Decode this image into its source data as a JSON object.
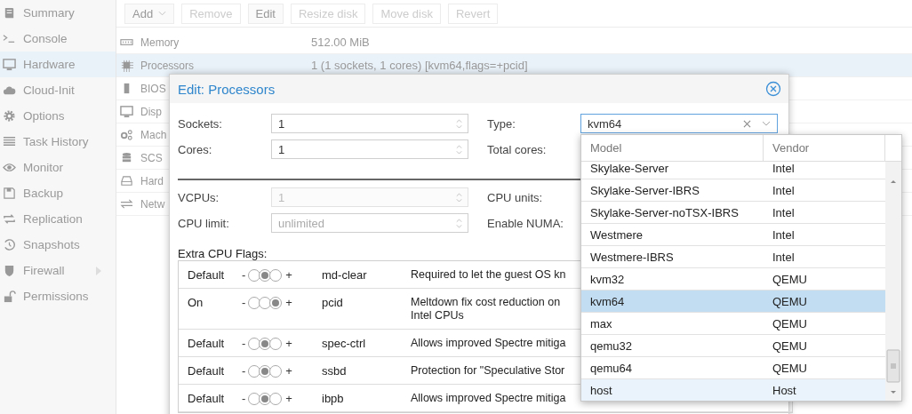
{
  "sidebar": {
    "items": [
      {
        "label": "Summary",
        "selected": false,
        "expandable": false
      },
      {
        "label": "Console",
        "selected": false,
        "expandable": false
      },
      {
        "label": "Hardware",
        "selected": true,
        "expandable": false
      },
      {
        "label": "Cloud-Init",
        "selected": false,
        "expandable": false
      },
      {
        "label": "Options",
        "selected": false,
        "expandable": false
      },
      {
        "label": "Task History",
        "selected": false,
        "expandable": false
      },
      {
        "label": "Monitor",
        "selected": false,
        "expandable": false
      },
      {
        "label": "Backup",
        "selected": false,
        "expandable": false
      },
      {
        "label": "Replication",
        "selected": false,
        "expandable": false
      },
      {
        "label": "Snapshots",
        "selected": false,
        "expandable": false
      },
      {
        "label": "Firewall",
        "selected": false,
        "expandable": true
      },
      {
        "label": "Permissions",
        "selected": false,
        "expandable": false
      }
    ]
  },
  "toolbar": {
    "buttons": [
      {
        "label": "Add",
        "disabled": false,
        "menu": true
      },
      {
        "label": "Remove",
        "disabled": true,
        "menu": false
      },
      {
        "label": "Edit",
        "disabled": false,
        "menu": false
      },
      {
        "label": "Resize disk",
        "disabled": true,
        "menu": false
      },
      {
        "label": "Move disk",
        "disabled": true,
        "menu": false
      },
      {
        "label": "Revert",
        "disabled": true,
        "menu": false
      }
    ]
  },
  "hardware": {
    "rows": [
      {
        "name": "Memory",
        "value": "512.00 MiB",
        "selected": false
      },
      {
        "name": "Processors",
        "value": "1 (1 sockets, 1 cores) [kvm64,flags=+pcid]",
        "selected": true
      },
      {
        "name": "BIOS",
        "selected": false
      },
      {
        "name": "Disp",
        "selected": false
      },
      {
        "name": "Mach",
        "selected": false
      },
      {
        "name": "SCS",
        "selected": false
      },
      {
        "name": "Hard",
        "selected": false
      },
      {
        "name": "Netw",
        "selected": false
      }
    ]
  },
  "dialog": {
    "title": "Edit: Processors",
    "basic_rows": [
      {
        "left": {
          "label": "Sockets:",
          "kind": "spinner",
          "value": "1",
          "disabled": false
        },
        "right": {
          "label": "Type:",
          "kind": "combo",
          "value": "kvm64"
        }
      },
      {
        "left": {
          "label": "Cores:",
          "kind": "spinner",
          "value": "1",
          "disabled": false
        },
        "right": {
          "label": "Total cores:"
        }
      }
    ],
    "advanced_rows": [
      {
        "left": {
          "label": "VCPUs:",
          "kind": "spinner",
          "value": "1",
          "disabled": true
        },
        "right": {
          "label": "CPU units:"
        }
      },
      {
        "left": {
          "label": "CPU limit:",
          "kind": "spinner",
          "placeholder": "unlimited",
          "disabled": false
        },
        "right": {
          "label": "Enable NUMA:"
        }
      }
    ],
    "flags": {
      "label": "Extra CPU Flags:",
      "rows": [
        {
          "state": "Default",
          "minus": "-",
          "plus": "+",
          "options": [
            {
              "selected": false
            },
            {
              "selected": true
            },
            {
              "selected": false
            }
          ],
          "name": "md-clear",
          "description": [
            "Required to let the guest OS kn"
          ]
        },
        {
          "state": "On",
          "minus": "-",
          "plus": "+",
          "options": [
            {
              "selected": false
            },
            {
              "selected": false
            },
            {
              "selected": true
            }
          ],
          "name": "pcid",
          "description": [
            "Meltdown fix cost reduction on",
            "Intel CPUs"
          ]
        },
        {
          "state": "Default",
          "minus": "-",
          "plus": "+",
          "options": [
            {
              "selected": false
            },
            {
              "selected": true
            },
            {
              "selected": false
            }
          ],
          "name": "spec-ctrl",
          "description": [
            "Allows improved Spectre mitiga"
          ]
        },
        {
          "state": "Default",
          "minus": "-",
          "plus": "+",
          "options": [
            {
              "selected": false
            },
            {
              "selected": true
            },
            {
              "selected": false
            }
          ],
          "name": "ssbd",
          "description": [
            "Protection for \"Speculative Stor"
          ]
        },
        {
          "state": "Default",
          "minus": "-",
          "plus": "+",
          "options": [
            {
              "selected": false
            },
            {
              "selected": true
            },
            {
              "selected": false
            }
          ],
          "name": "ibpb",
          "description": [
            "Allows improved Spectre mitiga"
          ]
        }
      ]
    }
  },
  "dropdown": {
    "columns": [
      "Model",
      "Vendor"
    ],
    "rows": [
      {
        "model": "Skylake-Server",
        "vendor": "Intel",
        "selected": false,
        "hovered": false
      },
      {
        "model": "Skylake-Server-IBRS",
        "vendor": "Intel",
        "selected": false,
        "hovered": false
      },
      {
        "model": "Skylake-Server-noTSX-IBRS",
        "vendor": "Intel",
        "selected": false,
        "hovered": false
      },
      {
        "model": "Westmere",
        "vendor": "Intel",
        "selected": false,
        "hovered": false
      },
      {
        "model": "Westmere-IBRS",
        "vendor": "Intel",
        "selected": false,
        "hovered": false
      },
      {
        "model": "kvm32",
        "vendor": "QEMU",
        "selected": false,
        "hovered": false
      },
      {
        "model": "kvm64",
        "vendor": "QEMU",
        "selected": true,
        "hovered": false
      },
      {
        "model": "max",
        "vendor": "QEMU",
        "selected": false,
        "hovered": false
      },
      {
        "model": "qemu32",
        "vendor": "QEMU",
        "selected": false,
        "hovered": false
      },
      {
        "model": "qemu64",
        "vendor": "QEMU",
        "selected": false,
        "hovered": false
      },
      {
        "model": "host",
        "vendor": "Host",
        "selected": false,
        "hovered": true
      }
    ]
  }
}
